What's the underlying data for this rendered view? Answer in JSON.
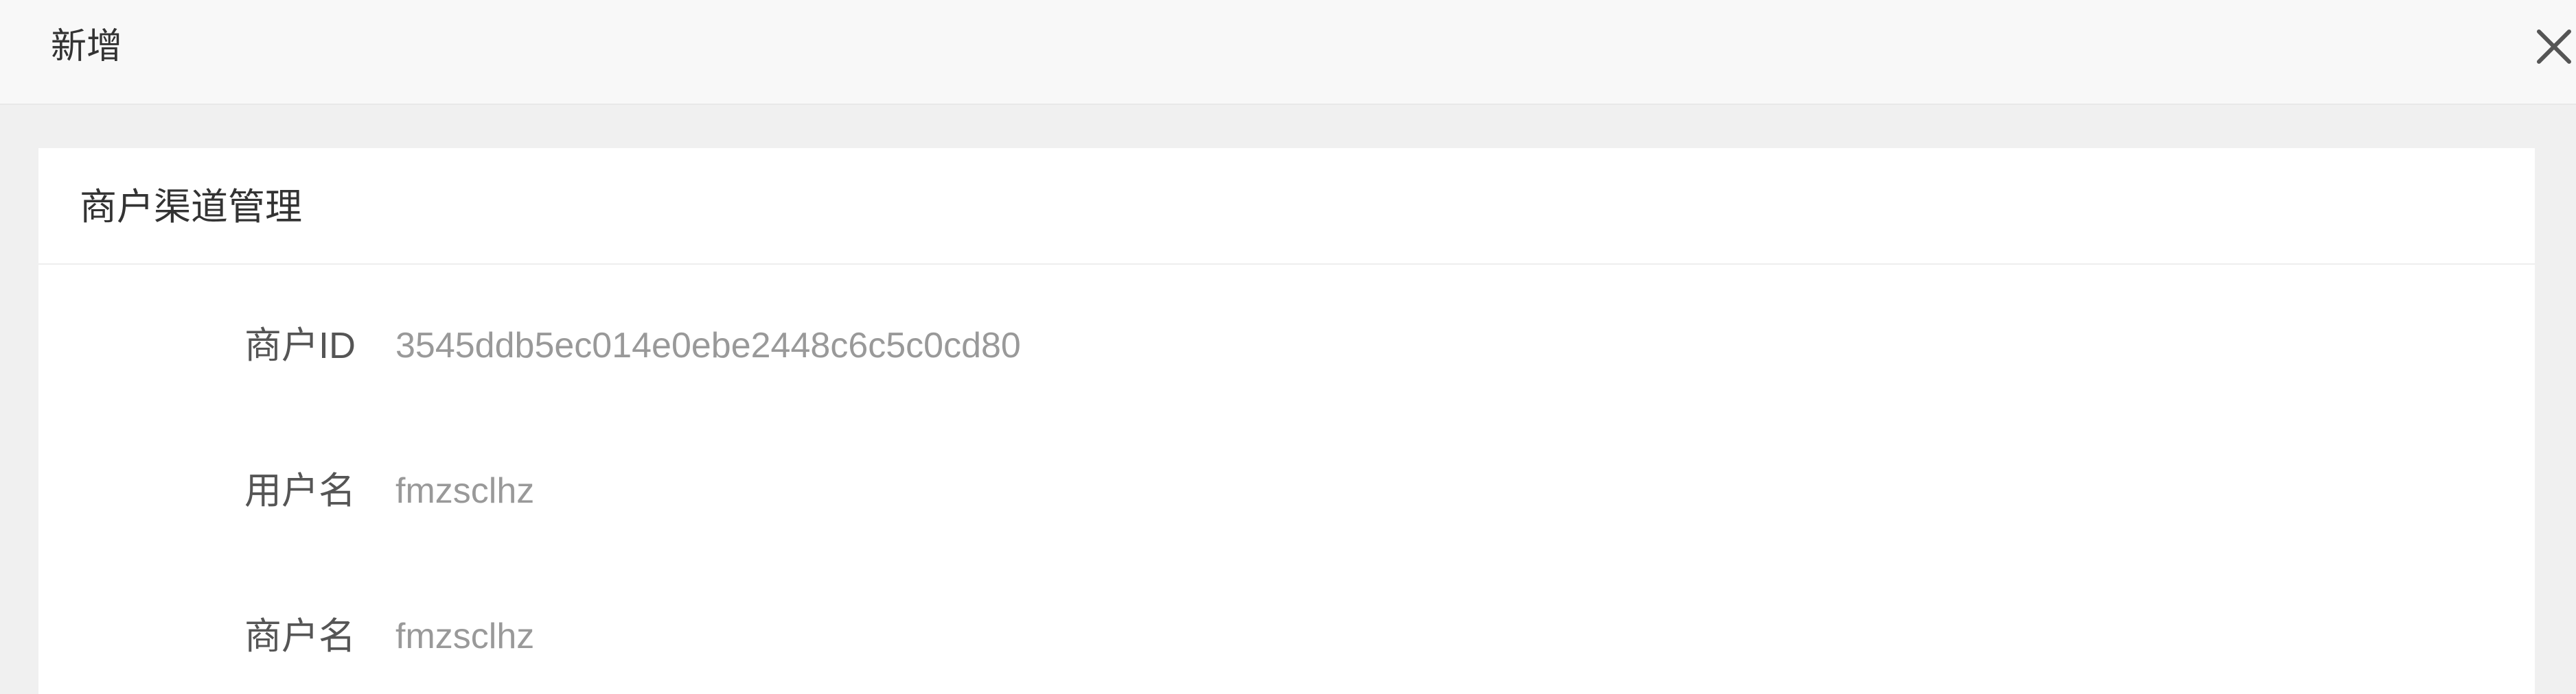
{
  "dialog": {
    "title": "新增",
    "close_icon": "close-icon"
  },
  "panel": {
    "title": "商户渠道管理",
    "fields": [
      {
        "label": "商户ID",
        "value": "3545ddb5ec014e0ebe2448c6c5c0cd80"
      },
      {
        "label": "用户名",
        "value": "fmzsclhz"
      },
      {
        "label": "商户名",
        "value": "fmzsclhz"
      }
    ]
  },
  "colors": {
    "page_background": "#f0f0f0",
    "header_background": "#f8f8f8",
    "panel_background": "#ffffff",
    "label_text": "#555555",
    "value_text": "#999999"
  }
}
